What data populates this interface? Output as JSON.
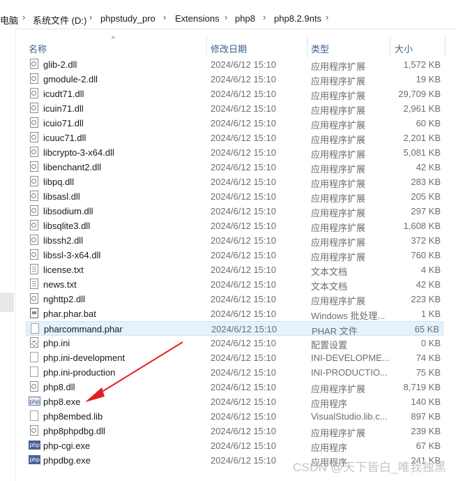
{
  "breadcrumb": [
    "电脑",
    "系统文件 (D:)",
    "phpstudy_pro",
    "Extensions",
    "php8",
    "php8.2.9nts"
  ],
  "columns": {
    "name": "名称",
    "date": "修改日期",
    "type": "类型",
    "size": "大小"
  },
  "files": [
    {
      "name": "glib-2.dll",
      "date": "2024/6/12 15:10",
      "type": "应用程序扩展",
      "size": "1,572 KB",
      "icon": "dll-file-icon"
    },
    {
      "name": "gmodule-2.dll",
      "date": "2024/6/12 15:10",
      "type": "应用程序扩展",
      "size": "19 KB",
      "icon": "dll-file-icon"
    },
    {
      "name": "icudt71.dll",
      "date": "2024/6/12 15:10",
      "type": "应用程序扩展",
      "size": "29,709 KB",
      "icon": "dll-file-icon"
    },
    {
      "name": "icuin71.dll",
      "date": "2024/6/12 15:10",
      "type": "应用程序扩展",
      "size": "2,961 KB",
      "icon": "dll-file-icon"
    },
    {
      "name": "icuio71.dll",
      "date": "2024/6/12 15:10",
      "type": "应用程序扩展",
      "size": "60 KB",
      "icon": "dll-file-icon"
    },
    {
      "name": "icuuc71.dll",
      "date": "2024/6/12 15:10",
      "type": "应用程序扩展",
      "size": "2,201 KB",
      "icon": "dll-file-icon"
    },
    {
      "name": "libcrypto-3-x64.dll",
      "date": "2024/6/12 15:10",
      "type": "应用程序扩展",
      "size": "5,081 KB",
      "icon": "dll-file-icon"
    },
    {
      "name": "libenchant2.dll",
      "date": "2024/6/12 15:10",
      "type": "应用程序扩展",
      "size": "42 KB",
      "icon": "dll-file-icon"
    },
    {
      "name": "libpq.dll",
      "date": "2024/6/12 15:10",
      "type": "应用程序扩展",
      "size": "283 KB",
      "icon": "dll-file-icon"
    },
    {
      "name": "libsasl.dll",
      "date": "2024/6/12 15:10",
      "type": "应用程序扩展",
      "size": "205 KB",
      "icon": "dll-file-icon"
    },
    {
      "name": "libsodium.dll",
      "date": "2024/6/12 15:10",
      "type": "应用程序扩展",
      "size": "297 KB",
      "icon": "dll-file-icon"
    },
    {
      "name": "libsqlite3.dll",
      "date": "2024/6/12 15:10",
      "type": "应用程序扩展",
      "size": "1,608 KB",
      "icon": "dll-file-icon"
    },
    {
      "name": "libssh2.dll",
      "date": "2024/6/12 15:10",
      "type": "应用程序扩展",
      "size": "372 KB",
      "icon": "dll-file-icon"
    },
    {
      "name": "libssl-3-x64.dll",
      "date": "2024/6/12 15:10",
      "type": "应用程序扩展",
      "size": "760 KB",
      "icon": "dll-file-icon"
    },
    {
      "name": "license.txt",
      "date": "2024/6/12 15:10",
      "type": "文本文档",
      "size": "4 KB",
      "icon": "text-file-icon"
    },
    {
      "name": "news.txt",
      "date": "2024/6/12 15:10",
      "type": "文本文档",
      "size": "42 KB",
      "icon": "text-file-icon"
    },
    {
      "name": "nghttp2.dll",
      "date": "2024/6/12 15:10",
      "type": "应用程序扩展",
      "size": "223 KB",
      "icon": "dll-file-icon"
    },
    {
      "name": "phar.phar.bat",
      "date": "2024/6/12 15:10",
      "type": "Windows 批处理...",
      "size": "1 KB",
      "icon": "batch-file-icon"
    },
    {
      "name": "pharcommand.phar",
      "date": "2024/6/12 15:10",
      "type": "PHAR 文件",
      "size": "65 KB",
      "icon": "blank-file-icon",
      "selected": true
    },
    {
      "name": "php.ini",
      "date": "2024/6/12 15:10",
      "type": "配置设置",
      "size": "0 KB",
      "icon": "settings-file-icon"
    },
    {
      "name": "php.ini-development",
      "date": "2024/6/12 15:10",
      "type": "INI-DEVELOPME...",
      "size": "74 KB",
      "icon": "blank-file-icon"
    },
    {
      "name": "php.ini-production",
      "date": "2024/6/12 15:10",
      "type": "INI-PRODUCTIO...",
      "size": "75 KB",
      "icon": "blank-file-icon"
    },
    {
      "name": "php8.dll",
      "date": "2024/6/12 15:10",
      "type": "应用程序扩展",
      "size": "8,719 KB",
      "icon": "dll-file-icon"
    },
    {
      "name": "php8.exe",
      "date": "2024/6/12 15:10",
      "type": "应用程序",
      "size": "140 KB",
      "icon": "php-exe-icon"
    },
    {
      "name": "php8embed.lib",
      "date": "2024/6/12 15:10",
      "type": "VisualStudio.lib.c...",
      "size": "897 KB",
      "icon": "blank-file-icon"
    },
    {
      "name": "php8phpdbg.dll",
      "date": "2024/6/12 15:10",
      "type": "应用程序扩展",
      "size": "239 KB",
      "icon": "dll-file-icon"
    },
    {
      "name": "php-cgi.exe",
      "date": "2024/6/12 15:10",
      "type": "应用程序",
      "size": "67 KB",
      "icon": "php-exe-icon"
    },
    {
      "name": "phpdbg.exe",
      "date": "2024/6/12 15:10",
      "type": "应用程序",
      "size": "241 KB",
      "icon": "php-exe-icon"
    }
  ],
  "icon_glyphs": {
    "php-exe-icon": "php"
  },
  "watermark": "CSDN @天下皆白_唯我独黑",
  "colors": {
    "selection": "#e5f1fb",
    "header_text": "#3b5f8a",
    "annotation_arrow": "#e02020"
  }
}
